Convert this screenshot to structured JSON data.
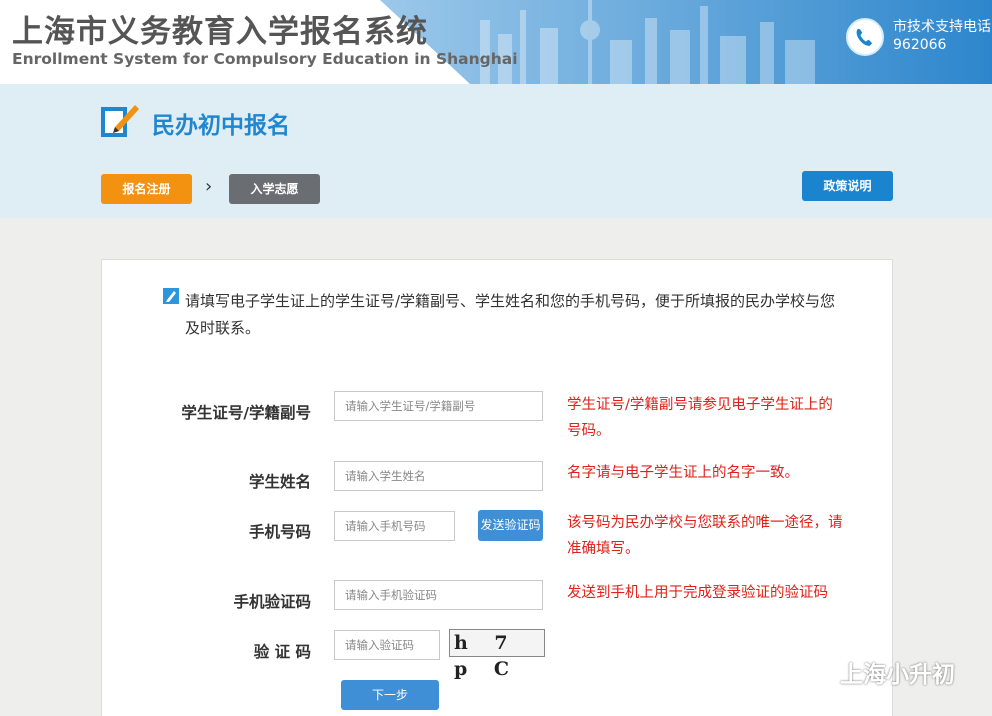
{
  "header": {
    "title_cn": "上海市义务教育入学报名系统",
    "title_en": "Enrollment System for Compulsory Education in Shanghai",
    "support_label": "市技术支持电话",
    "support_phone": "962066"
  },
  "section": {
    "title": "民办初中报名",
    "steps": [
      "报名注册",
      "入学志愿"
    ],
    "policy_button": "政策说明"
  },
  "notice": "请填写电子学生证上的学生证号/学籍副号、学生姓名和您的手机号码，便于所填报的民办学校与您及时联系。",
  "form": {
    "fields": [
      {
        "label": "学生证号/学籍副号",
        "placeholder": "请输入学生证号/学籍副号",
        "hint": "学生证号/学籍副号请参见电子学生证上的号码。"
      },
      {
        "label": "学生姓名",
        "placeholder": "请输入学生姓名",
        "hint": "名字请与电子学生证上的名字一致。"
      },
      {
        "label": "手机号码",
        "placeholder": "请输入手机号码",
        "hint": "该号码为民办学校与您联系的唯一途径，请准确填写。"
      },
      {
        "label": "手机验证码",
        "placeholder": "请输入手机验证码",
        "hint": "发送到手机上用于完成登录验证的验证码"
      },
      {
        "label": "验 证 码",
        "placeholder": "请输入验证码",
        "hint": ""
      }
    ],
    "send_code_button": "发送验证码",
    "captcha_text": "h 7 p C",
    "next_button": "下一步"
  },
  "watermark": "上海小升初",
  "colors": {
    "brand_blue": "#1a84cf",
    "step_active": "#f39211",
    "step_inactive": "#6a6e73",
    "hint_red": "#e0201a"
  }
}
